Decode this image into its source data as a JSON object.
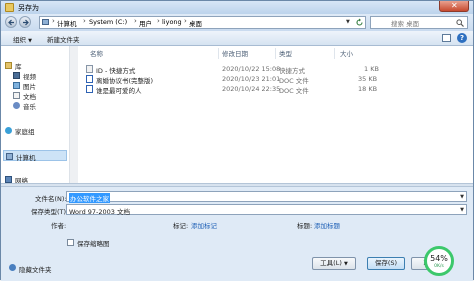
{
  "window": {
    "title": "另存为"
  },
  "address": {
    "crumbs": [
      "计算机",
      "System (C:)",
      "用户",
      "liyong",
      "桌面"
    ],
    "search_placeholder": "搜索 桌面"
  },
  "toolbar": {
    "organize": "组织",
    "new_folder": "新建文件夹"
  },
  "sidebar": {
    "items": [
      {
        "label": "库",
        "icon": "library-icon"
      },
      {
        "label": "视频",
        "icon": "video-icon"
      },
      {
        "label": "图片",
        "icon": "picture-icon"
      },
      {
        "label": "文档",
        "icon": "document-icon"
      },
      {
        "label": "音乐",
        "icon": "music-icon"
      },
      {
        "label": "家庭组",
        "icon": "homegroup-icon"
      },
      {
        "label": "计算机",
        "icon": "computer-icon"
      },
      {
        "label": "网络",
        "icon": "network-icon"
      }
    ]
  },
  "file_list": {
    "columns": [
      "名称",
      "修改日期",
      "类型",
      "大小"
    ],
    "rows": [
      {
        "name": "ID - 快捷方式",
        "date": "2020/10/22 15:08",
        "type": "快捷方式",
        "size": "1 KB",
        "icon": "shortcut-icon"
      },
      {
        "name": "离婚协议书(完整版)",
        "date": "2020/10/23 21:01",
        "type": "DOC 文件",
        "size": "35 KB",
        "icon": "doc-file-icon"
      },
      {
        "name": "谁是最可爱的人",
        "date": "2020/10/24 22:35",
        "type": "DOC 文件",
        "size": "18 KB",
        "icon": "doc-file-icon"
      }
    ]
  },
  "form": {
    "filename_label": "文件名(N):",
    "filename_value": "办公软件之家",
    "filetype_label": "保存类型(T):",
    "filetype_value": "Word 97-2003 文档",
    "author_label": "作者:",
    "author_value": "",
    "tags_label": "标记:",
    "tags_value": "添加标记",
    "title_label": "标题:",
    "title_value": "添加标题",
    "thumbnail_label": "保存缩略图"
  },
  "footer": {
    "hide_folders": "隐藏文件夹",
    "tools": "工具(L)",
    "save": "保存(S)",
    "cancel": "取消"
  },
  "gauge": {
    "percent": "54%",
    "speed": "0K/s"
  }
}
